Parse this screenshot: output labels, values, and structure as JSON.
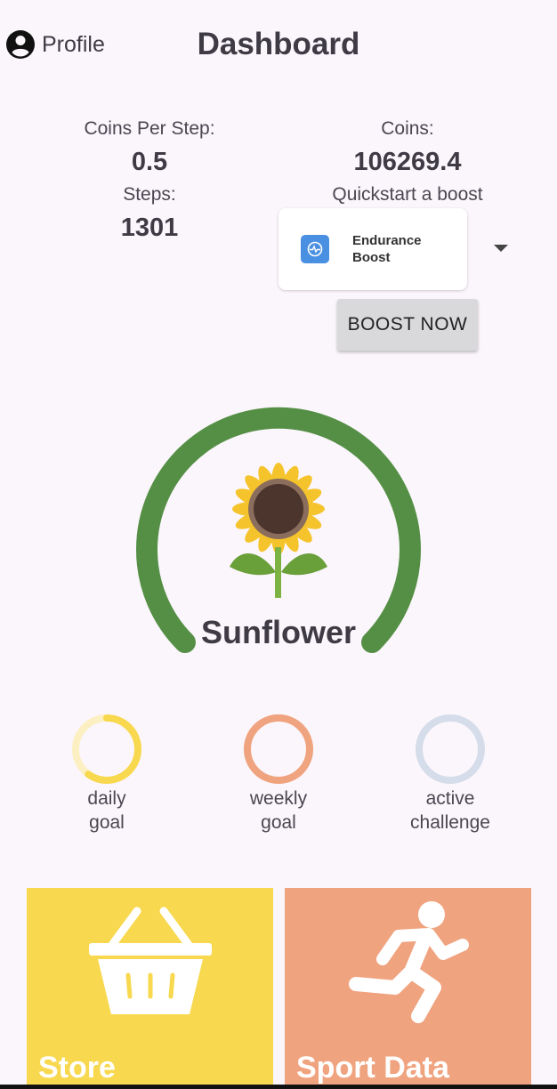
{
  "header": {
    "profile_label": "Profile",
    "title": "Dashboard",
    "profile_icon": "account-circle-icon"
  },
  "stats": {
    "coins_per_step_label": "Coins Per Step:",
    "coins_per_step_value": "0.5",
    "steps_label": "Steps:",
    "steps_value": "1301",
    "coins_label": "Coins:",
    "coins_value": "106269.4"
  },
  "boost": {
    "quickstart_label": "Quickstart a boost",
    "selected_boost": "Endurance Boost",
    "boost_icon": "heart-monitor-icon",
    "button_label": "BOOST NOW",
    "icon_color": "#4a90e2"
  },
  "plant": {
    "name": "Sunflower",
    "icon": "sunflower-icon",
    "gauge_color": "#558f45"
  },
  "goals": [
    {
      "label_line1": "daily",
      "label_line2": "goal",
      "color": "#f8d84e",
      "track_color": "#fcefc2",
      "progress": 0.6
    },
    {
      "label_line1": "weekly",
      "label_line2": "goal",
      "color": "#f0a37f",
      "track_color": "#f7d4c2",
      "progress": 1.0
    },
    {
      "label_line1": "active",
      "label_line2": "challenge",
      "color": "#d5dcea",
      "track_color": "#e4e9f1",
      "progress": 0.0
    }
  ],
  "tiles": {
    "store_label": "Store",
    "store_icon": "shopping-basket-icon",
    "store_color": "#f8d84e",
    "sport_label": "Sport Data",
    "sport_icon": "running-person-icon",
    "sport_color": "#f0a37f"
  }
}
